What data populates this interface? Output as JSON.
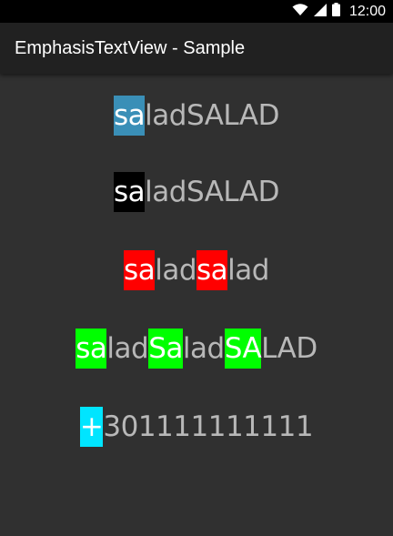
{
  "status_bar": {
    "time": "12:00",
    "icons": [
      "wifi-icon",
      "cellular-signal-icon",
      "battery-icon"
    ]
  },
  "app_bar": {
    "title": "EmphasisTextView - Sample"
  },
  "samples": [
    {
      "segments": [
        {
          "text": "sa",
          "emphasis": true,
          "bg": "#3a8fb7"
        },
        {
          "text": "ladSALAD",
          "emphasis": false
        }
      ]
    },
    {
      "segments": [
        {
          "text": "sa",
          "emphasis": true,
          "bg": "#000000"
        },
        {
          "text": "ladSALAD",
          "emphasis": false
        }
      ]
    },
    {
      "segments": [
        {
          "text": "sa",
          "emphasis": true,
          "bg": "#ff0000"
        },
        {
          "text": "lad",
          "emphasis": false
        },
        {
          "text": "sa",
          "emphasis": true,
          "bg": "#ff0000"
        },
        {
          "text": "lad",
          "emphasis": false
        }
      ]
    },
    {
      "segments": [
        {
          "text": "sa",
          "emphasis": true,
          "bg": "#00ff00"
        },
        {
          "text": "lad",
          "emphasis": false
        },
        {
          "text": "Sa",
          "emphasis": true,
          "bg": "#00ff00"
        },
        {
          "text": "lad",
          "emphasis": false
        },
        {
          "text": "SA",
          "emphasis": true,
          "bg": "#00ff00"
        },
        {
          "text": "LAD",
          "emphasis": false
        }
      ]
    },
    {
      "segments": [
        {
          "text": "+",
          "emphasis": true,
          "bg": "#00e5ff"
        },
        {
          "text": "301111111111",
          "emphasis": false
        }
      ]
    }
  ],
  "colors": {
    "background": "#303030",
    "app_bar": "#212121",
    "normal_text": "#b8b8b8",
    "emphasis_text": "#ffffff"
  }
}
